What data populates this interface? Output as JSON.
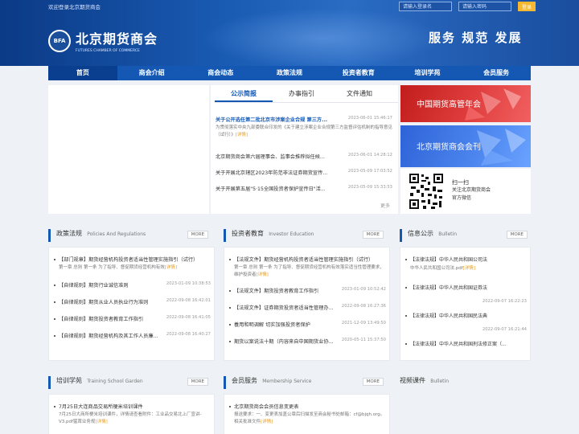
{
  "header": {
    "welcome": "欢迎登录北京期货商会",
    "username_placeholder": "请输入登录名",
    "password_placeholder": "请输入密码",
    "login_label": "登录",
    "logo_badge": "BFA",
    "logo_name": "北京期货商会",
    "logo_en": "FUTURES CHAMBER OF COMMERCE",
    "slogan": "服务  规范  发展"
  },
  "nav": [
    "首页",
    "商会介绍",
    "商会动态",
    "政策法规",
    "投资者教育",
    "培训学苑",
    "会员服务"
  ],
  "news": {
    "tabs": [
      "公示简报",
      "办事指引",
      "文件通知"
    ],
    "items": [
      {
        "title": "关于公开选任第二批北京市涉案企业合规 第三方...",
        "date": "2023-06-01 15:46:17",
        "desc": "为贯彻落实中央九部委联合印发的《关于建立涉案企业合规第三方监督评估机制的指导意见（试行）》",
        "more": "[详情]"
      },
      {
        "title": "北京期货商会第六届理事会、监事会推荐拟任候...",
        "date": "2023-06-01 14:28:12"
      },
      {
        "title": "关于开展北京辖区2023年防范非法证券期货宣传...",
        "date": "2023-05-09 17:03:52"
      },
      {
        "title": "关于开展第五届\"5·15全国投资者保护宣传日\"活...",
        "date": "2023-05-09 15:33:53"
      }
    ],
    "more": "更多"
  },
  "banners": {
    "banner1": "中国期货高管年会",
    "banner2": "北京期货商会会刊",
    "qr_title": "扫一扫",
    "qr_line1": "关注北京期货商会",
    "qr_line2": "官方微信"
  },
  "policy": {
    "title": "政策法规",
    "en": "Policies And Regulations",
    "more": "MORE",
    "featured": {
      "title": "【部门规章】期货经营机构投资者适当性管理实施指引（试行）",
      "desc": "第一章 总则      第一条    为了指导、督促期货经营机构有效",
      "more": "[详情]"
    },
    "items": [
      {
        "title": "【自律规则】期货行业诚信准则",
        "date": "2023-01-09 10:38:53"
      },
      {
        "title": "【自律规则】期货从业人员执业行为准则",
        "date": "2022-09-08 16:42:01"
      },
      {
        "title": "【自律规则】期货投资者教育工作指引",
        "date": "2022-09-08 16:41:05"
      },
      {
        "title": "【自律规则】期货经营机构及其工作人员廉...",
        "date": "2022-09-08 16:40:27"
      }
    ]
  },
  "investor": {
    "title": "投资者教育",
    "en": "Investor Education",
    "more": "MORE",
    "featured": {
      "title": "【法规文件】期货经营机构投资者适当性管理实施指引（试行）",
      "desc": "第一章 总则      第一条    为了指导、督促期货经营机构有效落实适当性管理要求，维护投资者",
      "more": "[详情]"
    },
    "items": [
      {
        "title": "【法规文件】期货投资者教育工作指引",
        "date": "2023-01-09 10:52:42"
      },
      {
        "title": "【法规文件】证券期货投资者适当性管理办...",
        "date": "2022-09-08 16:27:36"
      },
      {
        "title": "養用和明调解 切实加强投资者保护",
        "date": "2021-12-09 13:49:50"
      },
      {
        "title": "期货以案说法十期（内容来自中国期货业协...",
        "date": "2020-05-11 15:37:50"
      }
    ]
  },
  "info": {
    "title": "信息公示",
    "en": "Bulletin",
    "more": "MORE",
    "items": [
      {
        "title": "【法律法规】中华人民共和国公司法",
        "desc": "中华人民共和国公司法.pdf",
        "more": "[详情]"
      },
      {
        "title": "【法律法规】中华人民共和国证券法",
        "date": "2022-09-07 16:22:23"
      },
      {
        "title": "【法律法规】中华人民共和国民法典",
        "date": "2022-09-07 16:21:44"
      },
      {
        "title": "【法律法规】中华人民共和国刑法修正案（..."
      }
    ]
  },
  "training": {
    "title": "培训学苑",
    "en": "Training School Garden",
    "more": "MORE",
    "featured": {
      "title": "7月25日大连商品交易所梗米培训课件",
      "desc": "7月25日大商所梗米培训课件，详情请查看附件：工业品交易北上厂宣讲-V3.pdf猛茸业务规",
      "more": "[详情]"
    }
  },
  "member": {
    "title": "会员服务",
    "en": "Membership Service",
    "more": "MORE",
    "featured": {
      "title": "北京期货商会会员信息变更表",
      "desc": "报送要求：一、变更表加盖公章后扫描发至商会秘书处邮箱：cf@bjqh.org。相关批准文件",
      "more": "[详情]"
    }
  },
  "video": {
    "title": "视频课件",
    "en": "Bulletin"
  }
}
